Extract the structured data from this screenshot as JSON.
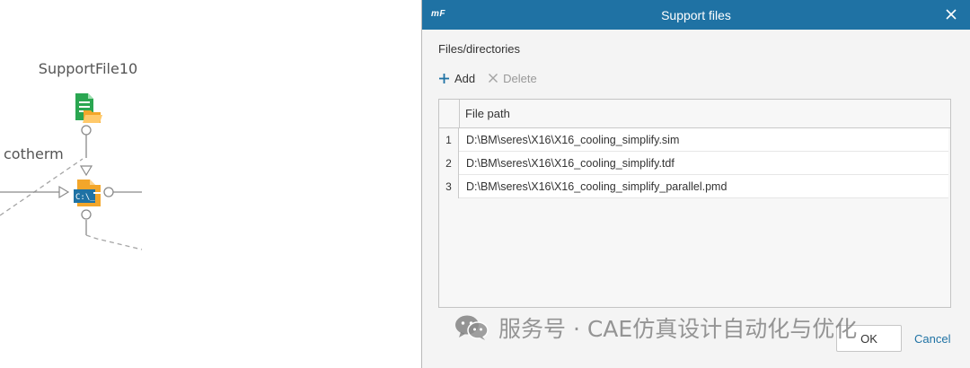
{
  "canvas": {
    "node_title": "SupportFile10",
    "partial_label": "cotherm",
    "terminal_text": "C:\\_"
  },
  "dialog": {
    "app_logo": "mF",
    "title": "Support files",
    "section_label": "Files/directories",
    "toolbar": {
      "add_label": "Add",
      "delete_label": "Delete"
    },
    "table": {
      "column_header": "File path",
      "rows": [
        {
          "index": "1",
          "path": "D:\\BM\\seres\\X16\\X16_cooling_simplify.sim"
        },
        {
          "index": "2",
          "path": "D:\\BM\\seres\\X16\\X16_cooling_simplify.tdf"
        },
        {
          "index": "3",
          "path": "D:\\BM\\seres\\X16\\X16_cooling_simplify_parallel.pmd"
        }
      ]
    },
    "ok_label": "OK",
    "cancel_label": "Cancel"
  },
  "watermark": {
    "text": "服务号 · CAE仿真设计自动化与优化"
  },
  "colors": {
    "titlebar": "#1f72a4",
    "cancel_link": "#1f72a4",
    "file_icon_green": "#2aa651",
    "file_icon_orange": "#f3a62a"
  }
}
